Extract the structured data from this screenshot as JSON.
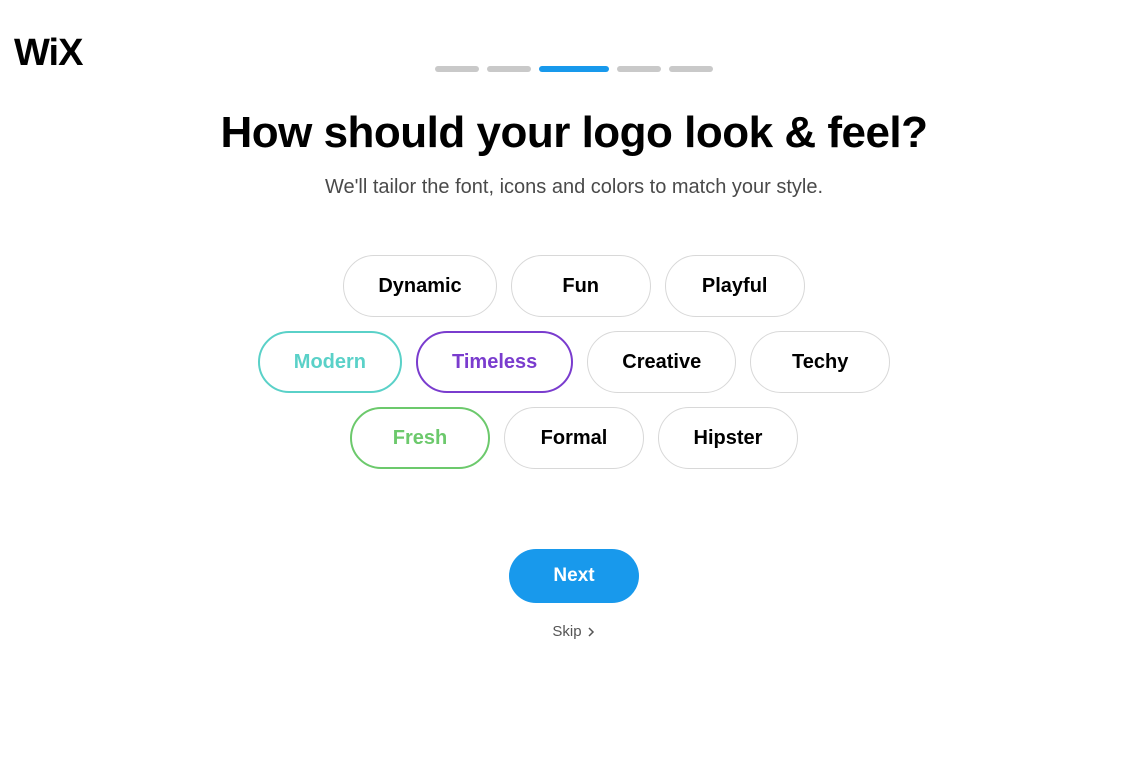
{
  "brand": {
    "logo_text": "WiX"
  },
  "progress": {
    "total": 5,
    "active_index": 2
  },
  "heading": "How should your logo look & feel?",
  "subheading": "We'll tailor the font, icons and colors to match your style.",
  "style_options": {
    "row1": [
      {
        "label": "Dynamic",
        "variant": "default"
      },
      {
        "label": "Fun",
        "variant": "default"
      },
      {
        "label": "Playful",
        "variant": "default"
      }
    ],
    "row2": [
      {
        "label": "Modern",
        "variant": "modern"
      },
      {
        "label": "Timeless",
        "variant": "timeless"
      },
      {
        "label": "Creative",
        "variant": "default"
      },
      {
        "label": "Techy",
        "variant": "default"
      }
    ],
    "row3": [
      {
        "label": "Fresh",
        "variant": "fresh"
      },
      {
        "label": "Formal",
        "variant": "default"
      },
      {
        "label": "Hipster",
        "variant": "default"
      }
    ]
  },
  "actions": {
    "next_label": "Next",
    "skip_label": "Skip"
  },
  "colors": {
    "accent_blue": "#1899ec",
    "modern_teal": "#5ad1c8",
    "timeless_purple": "#7a3cce",
    "fresh_green": "#6cc96c"
  }
}
